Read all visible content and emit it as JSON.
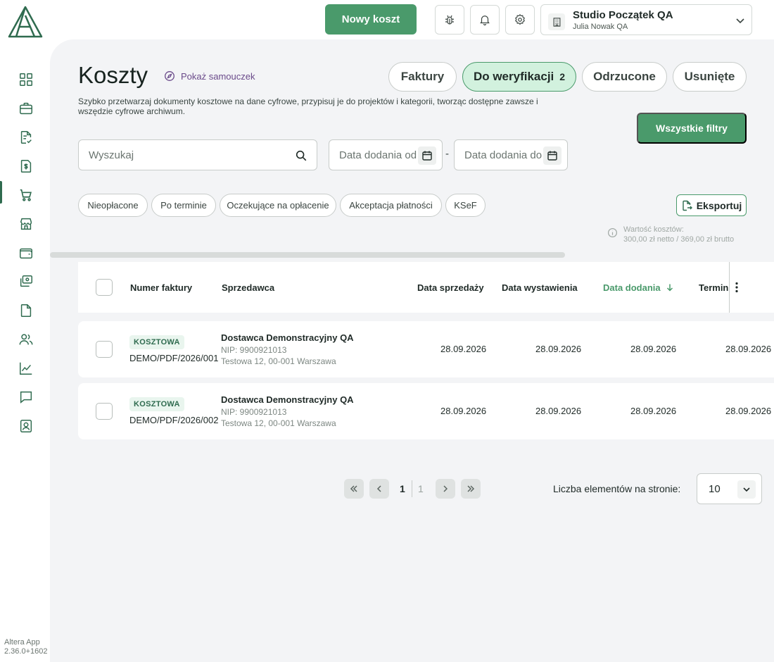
{
  "header": {
    "new_cost_label": "Nowy koszt",
    "company_name": "Studio Początek QA",
    "company_user": "Julia Nowak QA"
  },
  "sidebar": {
    "items": [
      {
        "icon": "dashboard-icon"
      },
      {
        "icon": "briefcase-icon"
      },
      {
        "icon": "invoice-check-icon"
      },
      {
        "icon": "revenue-document-icon"
      },
      {
        "icon": "cart-icon",
        "active": true
      },
      {
        "icon": "store-icon"
      },
      {
        "icon": "wallet-icon"
      },
      {
        "icon": "banking-icon"
      },
      {
        "icon": "document-icon"
      },
      {
        "icon": "users-icon"
      },
      {
        "icon": "chart-icon"
      },
      {
        "icon": "chat-icon"
      },
      {
        "icon": "contacts-icon"
      }
    ],
    "version_line1": "Altera App",
    "version_line2": "2.36.0+1602"
  },
  "page": {
    "title": "Koszty",
    "tutorial_label": "Pokaż samouczek",
    "description": "Szybko przetwarzaj dokumenty kosztowe na dane cyfrowe, przypisuj je do projektów i kategorii, tworząc dostępne zawsze i wszędzie cyfrowe archiwum."
  },
  "tabs": [
    {
      "label": "Faktury",
      "count": ""
    },
    {
      "label": "Do weryfikacji",
      "count": "2",
      "active": true
    },
    {
      "label": "Odrzucone",
      "count": ""
    },
    {
      "label": "Usunięte",
      "count": ""
    }
  ],
  "filters": {
    "all_filters_label": "Wszystkie filtry",
    "search_placeholder": "Wyszukaj",
    "date_from_placeholder": "Data dodania od",
    "date_to_placeholder": "Data dodania do",
    "date_separator": "-",
    "chips": [
      "Nieopłacone",
      "Po terminie",
      "Oczekujące na opłacenie",
      "Akceptacja płatności",
      "KSeF"
    ]
  },
  "export_label": "Eksportuj",
  "cost_value": {
    "label": "Wartość kosztów:",
    "value": "300,00 zł netto / 369,00 zł brutto"
  },
  "table": {
    "columns": [
      "Numer faktury",
      "Sprzedawca",
      "Data sprzedaży",
      "Data wystawienia",
      "Data dodania",
      "Termin"
    ],
    "sorted_column": "Data dodania",
    "rows": [
      {
        "badge": "KOSZTOWA",
        "invoice_number": "DEMO/PDF/2026/001",
        "seller_name": "Dostawca Demonstracyjny QA",
        "seller_nip": "NIP: 9900921013",
        "seller_address": "Testowa 12, 00-001 Warszawa",
        "sale_date": "28.09.2026",
        "issue_date": "28.09.2026",
        "added_date": "28.09.2026",
        "due_date": "28.09.2026"
      },
      {
        "badge": "KOSZTOWA",
        "invoice_number": "DEMO/PDF/2026/002",
        "seller_name": "Dostawca Demonstracyjny QA",
        "seller_nip": "NIP: 9900921013",
        "seller_address": "Testowa 12, 00-001 Warszawa",
        "sale_date": "28.09.2026",
        "issue_date": "28.09.2026",
        "added_date": "28.09.2026",
        "due_date": "28.09.2026"
      }
    ]
  },
  "pagination": {
    "current_page": "1",
    "total_pages": "1",
    "per_page_label": "Liczba elementów na stronie:",
    "per_page_value": "10"
  },
  "colors": {
    "brand_green": "#4a9a6b",
    "active_tab_bg": "#d2f1de",
    "panel_bg": "#f3f4f6"
  }
}
